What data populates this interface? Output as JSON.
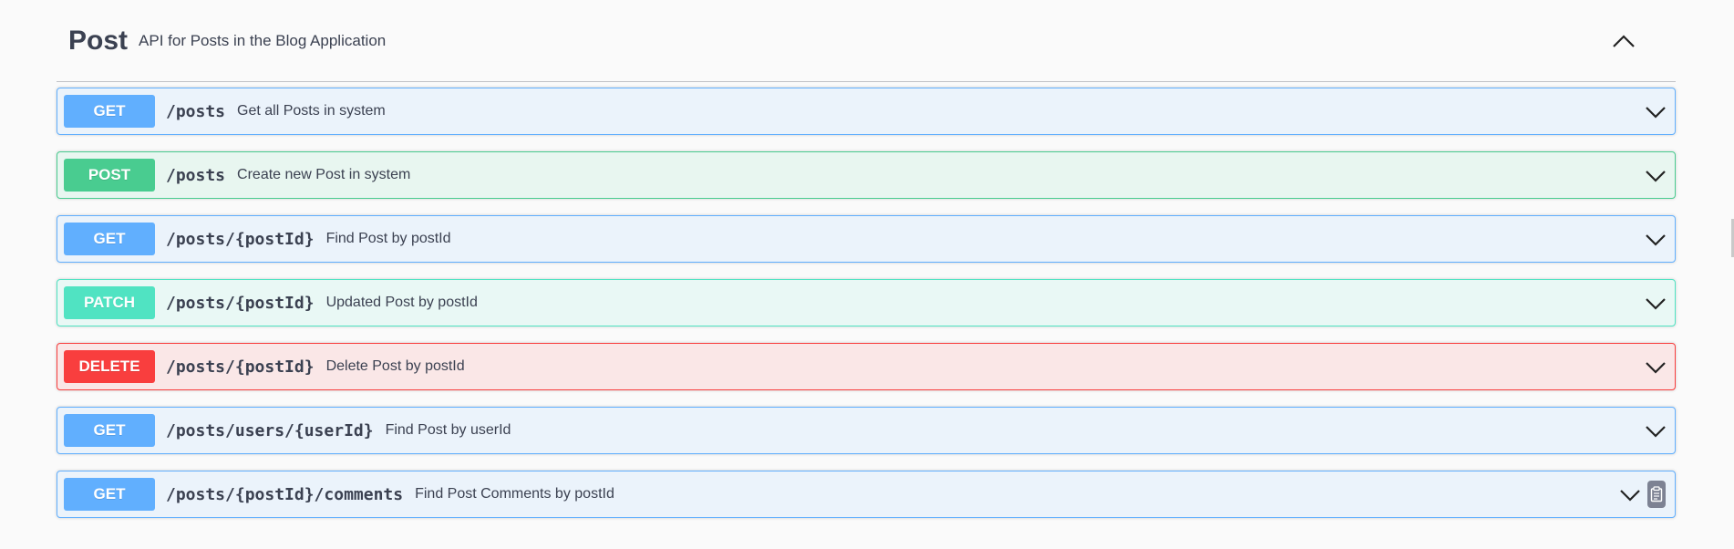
{
  "tag": {
    "title": "Post",
    "description": "API for Posts in the Blog Application",
    "toggle_icon": "chevron-up-icon"
  },
  "colors": {
    "get": "#61affe",
    "post": "#49cc90",
    "patch": "#50e3c2",
    "delete": "#f93e3e"
  },
  "operations": [
    {
      "method": "GET",
      "path": "/posts",
      "summary": "Get all Posts in system"
    },
    {
      "method": "POST",
      "path": "/posts",
      "summary": "Create new Post in system"
    },
    {
      "method": "GET",
      "path": "/posts/{postId}",
      "summary": "Find Post by postId"
    },
    {
      "method": "PATCH",
      "path": "/posts/{postId}",
      "summary": "Updated Post by postId"
    },
    {
      "method": "DELETE",
      "path": "/posts/{postId}",
      "summary": "Delete Post by postId"
    },
    {
      "method": "GET",
      "path": "/posts/users/{userId}",
      "summary": "Find Post by userId"
    },
    {
      "method": "GET",
      "path": "/posts/{postId}/comments",
      "summary": "Find Post Comments by postId"
    }
  ]
}
